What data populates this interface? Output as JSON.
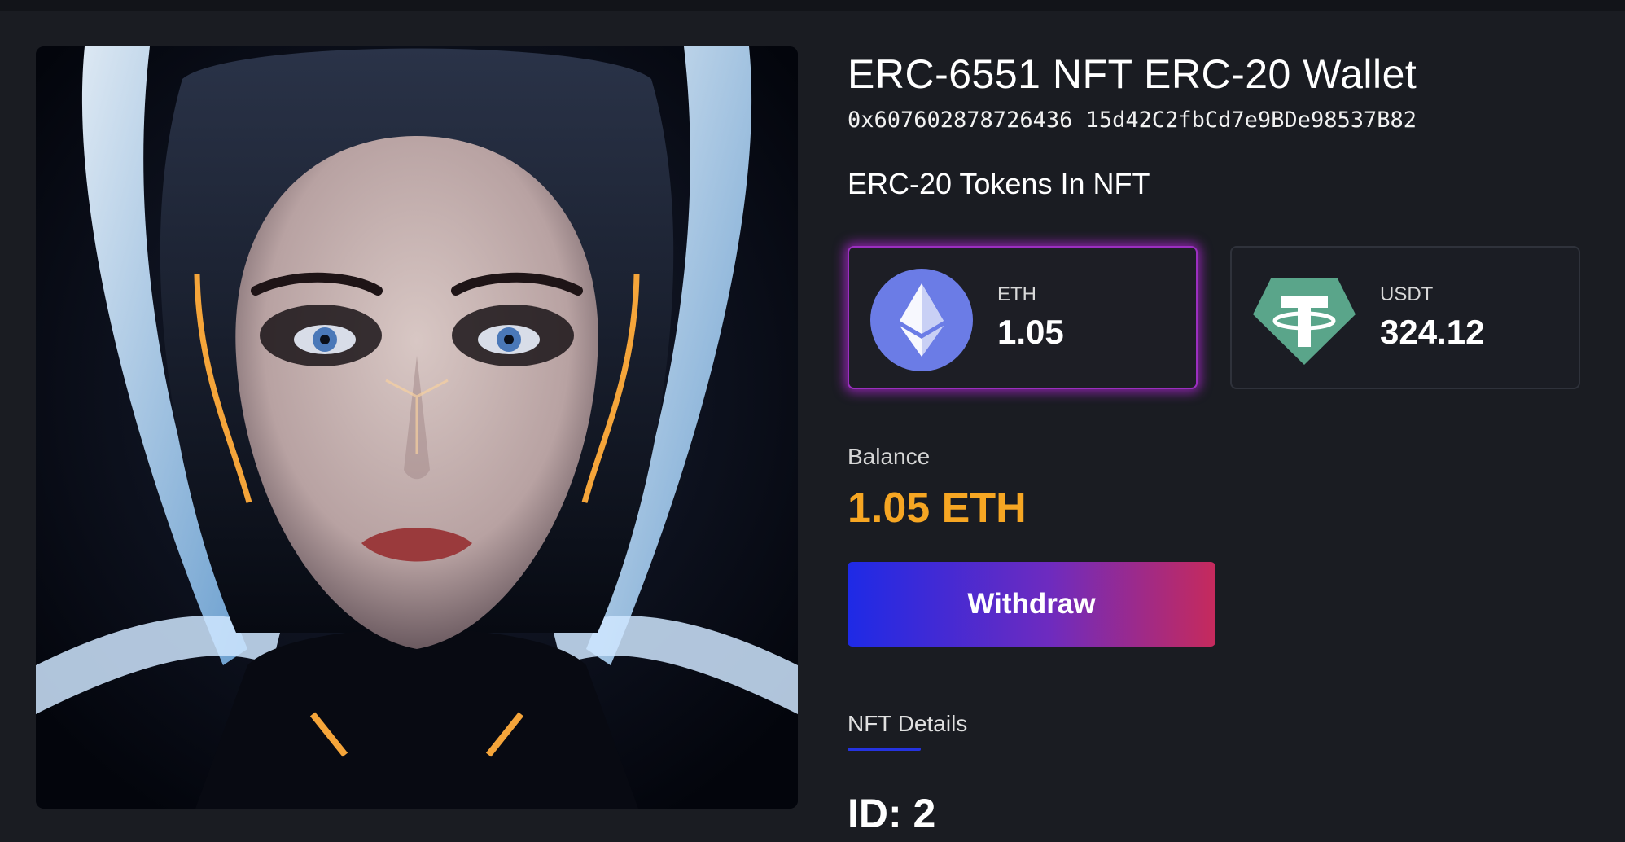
{
  "nft": {
    "title": "ERC-6551 NFT ERC-20 Wallet",
    "address": "0x607602878726436 15d42C2fbCd7e9BDe98537B82",
    "image_alt": "NFT artwork"
  },
  "tokens_section": {
    "title": "ERC-20 Tokens In NFT",
    "tokens": [
      {
        "symbol": "ETH",
        "amount": "1.05",
        "icon": "ethereum-icon",
        "selected": true
      },
      {
        "symbol": "USDT",
        "amount": "324.12",
        "icon": "tether-icon",
        "selected": false
      }
    ]
  },
  "balance": {
    "label": "Balance",
    "value": "1.05 ETH"
  },
  "actions": {
    "withdraw_label": "Withdraw"
  },
  "details": {
    "tab_label": "NFT Details",
    "id_text": "ID: 2"
  },
  "colors": {
    "background": "#1a1c22",
    "balance_accent": "#f6a623",
    "selected_glow": "#be28e6",
    "eth_icon": "#6b7ce6",
    "usdt_icon": "#5aa58a",
    "button_gradient_start": "#1e2ae6",
    "button_gradient_end": "#c62a5c",
    "tab_underline": "#2533e0"
  }
}
